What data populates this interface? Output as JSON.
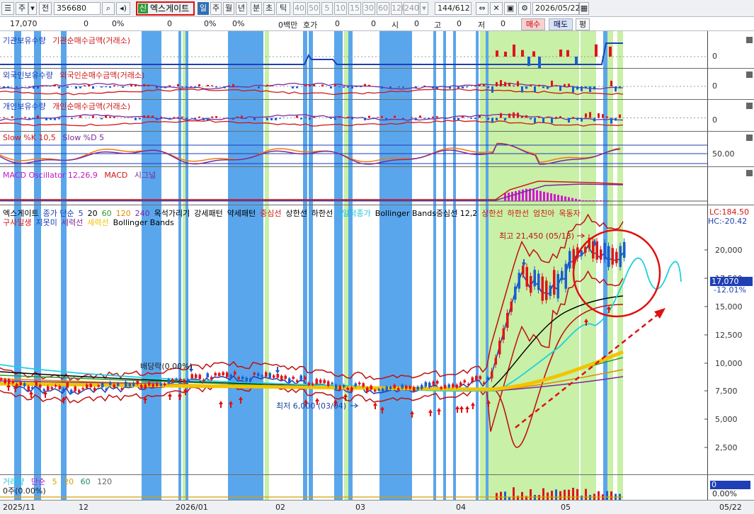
{
  "toolbar": {
    "prefix_btn": "주",
    "prefix_dd": "▾",
    "prev_btn": "전",
    "code": "356680",
    "new_tag": "신",
    "stock_name": "엑스게이트",
    "periods": [
      "일",
      "주",
      "월",
      "년",
      "분",
      "초",
      "틱"
    ],
    "intervals": [
      "40",
      "50",
      "5",
      "10",
      "15",
      "30",
      "60",
      "120",
      "240"
    ],
    "page": "144/612",
    "date": "2026/05/22"
  },
  "quote": {
    "price": "17,070",
    "v1": "0",
    "p1": "0%",
    "v2": "0",
    "p2": "0%",
    "p3": "0%",
    "amount": "0백만",
    "hoga_label": "호가",
    "hoga_v1": "0",
    "hoga_v2": "0",
    "si_label": "시",
    "si_v": "0",
    "go_label": "고",
    "go_v": "0",
    "jeo_label": "저",
    "jeo_v": "0",
    "buy": "매수",
    "sell": "매도",
    "avg": "평"
  },
  "panels": {
    "inst": {
      "l1": "기관보유수량",
      "l2": "기관순매수금액(거래소)",
      "y": "0"
    },
    "foreign": {
      "l1": "외국인보유수량",
      "l2": "외국인순매수금액(거래소)",
      "y": "0"
    },
    "indiv": {
      "l1": "개인보유수량",
      "l2": "개인순매수금액(거래소)",
      "y": "0"
    },
    "slow": {
      "l1": "Slow %K 10,5",
      "l2": "Slow %D 5",
      "y": "50.00"
    },
    "macd": {
      "l1": "MACD Oscillator 12,26,9",
      "l2": "MACD",
      "l3": "시그널"
    }
  },
  "main_legend": {
    "row1": [
      {
        "t": "엑스게이트",
        "c": "#000000"
      },
      {
        "t": "종가 단순",
        "c": "#1f3fb5"
      },
      {
        "t": "5",
        "c": "#1f3fb5"
      },
      {
        "t": "20",
        "c": "#000000"
      },
      {
        "t": "60",
        "c": "#2a9a2a"
      },
      {
        "t": "120",
        "c": "#e08a00"
      },
      {
        "t": "240",
        "c": "#7a2a9a"
      },
      {
        "t": "옥석가리기",
        "c": "#000000"
      },
      {
        "t": "강세패턴",
        "c": "#000000"
      },
      {
        "t": "약세패턴",
        "c": "#000000"
      },
      {
        "t": "중심선",
        "c": "#d01818"
      },
      {
        "t": "상한선",
        "c": "#000000"
      },
      {
        "t": "하한선",
        "c": "#000000"
      },
      {
        "t": "3일적종가",
        "c": "#1cc7d8"
      },
      {
        "t": "Bollinger Bands중심선 12,2",
        "c": "#000000"
      },
      {
        "t": "상한선",
        "c": "#d01818"
      },
      {
        "t": "하한선",
        "c": "#d01818"
      },
      {
        "t": "엄친아",
        "c": "#d01818"
      },
      {
        "t": "옥동자",
        "c": "#d01818"
      }
    ],
    "row2": [
      {
        "t": "구사일생",
        "c": "#d01818"
      },
      {
        "t": "지못미",
        "c": "#1f3fb5"
      },
      {
        "t": "세력선",
        "c": "#7a2a9a"
      },
      {
        "t": "세력선",
        "c": "#f2c400"
      },
      {
        "t": "Bollinger Bands",
        "c": "#000000"
      }
    ]
  },
  "main": {
    "lc": "LC:184.50",
    "hc": "HC:-20.42",
    "price_tag": "17,070",
    "pct_tag": "-12.01%",
    "y_ticks": [
      "20,000",
      "17,500",
      "15,000",
      "12,500",
      "10,000",
      "7,500",
      "5,000",
      "2,500"
    ],
    "high_label": "최고 21,450 (05/13)",
    "low_label": "최저 6,000 (03/04)",
    "div_label": "배당락(0.00%)"
  },
  "volume": {
    "l1": "거래량",
    "l2": "단순",
    "l3": "5",
    "l4": "20",
    "l5": "60",
    "l6": "120",
    "sub": "0주(0.00%)",
    "tag": "0",
    "pct": "0.00%"
  },
  "xaxis": [
    "2025/11",
    "12",
    "2026/01",
    "02",
    "03",
    "04",
    "05",
    "05/22"
  ],
  "colors": {
    "blue_band": "#5aa6ec",
    "green_band": "#c8f0a6",
    "up": "#e0141a",
    "down": "#1a5fd0",
    "accent_red": "#e01010"
  }
}
